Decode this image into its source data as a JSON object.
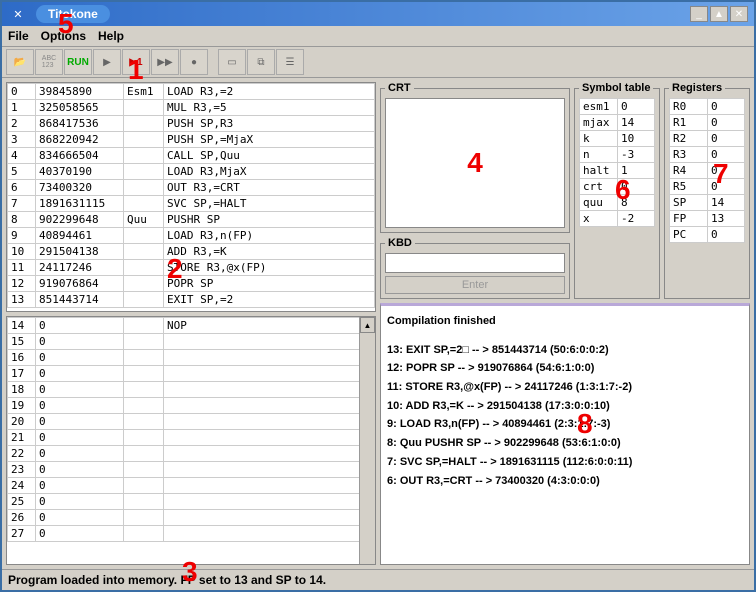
{
  "window": {
    "title": "Titokone"
  },
  "menu": {
    "file": "File",
    "options": "Options",
    "help": "Help"
  },
  "toolbar": {
    "open": "📂",
    "abc": "ABC\n123",
    "run": "RUN",
    "step": "▶",
    "stepn": "▶1",
    "ff": "▶▶",
    "stop": "●"
  },
  "code": [
    {
      "addr": "0",
      "val": "39845890",
      "lbl": "Esm1",
      "inst": "LOAD R3,=2"
    },
    {
      "addr": "1",
      "val": "325058565",
      "lbl": "",
      "inst": "MUL  R3,=5"
    },
    {
      "addr": "2",
      "val": "868417536",
      "lbl": "",
      "inst": "PUSH SP,R3"
    },
    {
      "addr": "3",
      "val": "868220942",
      "lbl": "",
      "inst": "PUSH SP,=MjaX"
    },
    {
      "addr": "4",
      "val": "834666504",
      "lbl": "",
      "inst": "CALL SP,Quu"
    },
    {
      "addr": "5",
      "val": "40370190",
      "lbl": "",
      "inst": "LOAD R3,MjaX"
    },
    {
      "addr": "6",
      "val": "73400320",
      "lbl": "",
      "inst": "OUT  R3,=CRT"
    },
    {
      "addr": "7",
      "val": "1891631115",
      "lbl": "",
      "inst": "SVC  SP,=HALT"
    },
    {
      "addr": "8",
      "val": "902299648",
      "lbl": "Quu",
      "inst": "PUSHR SP"
    },
    {
      "addr": "9",
      "val": "40894461",
      "lbl": "",
      "inst": "LOAD  R3,n(FP)"
    },
    {
      "addr": "10",
      "val": "291504138",
      "lbl": "",
      "inst": "ADD   R3,=K"
    },
    {
      "addr": "11",
      "val": "24117246",
      "lbl": "",
      "inst": "STORE R3,@x(FP)"
    },
    {
      "addr": "12",
      "val": "919076864",
      "lbl": "",
      "inst": "POPR  SP"
    },
    {
      "addr": "13",
      "val": "851443714",
      "lbl": "",
      "inst": "EXIT  SP,=2"
    }
  ],
  "mem": [
    {
      "addr": "14",
      "val": "0",
      "lbl": "",
      "inst": "NOP"
    },
    {
      "addr": "15",
      "val": "0",
      "lbl": "",
      "inst": ""
    },
    {
      "addr": "16",
      "val": "0",
      "lbl": "",
      "inst": ""
    },
    {
      "addr": "17",
      "val": "0",
      "lbl": "",
      "inst": ""
    },
    {
      "addr": "18",
      "val": "0",
      "lbl": "",
      "inst": ""
    },
    {
      "addr": "19",
      "val": "0",
      "lbl": "",
      "inst": ""
    },
    {
      "addr": "20",
      "val": "0",
      "lbl": "",
      "inst": ""
    },
    {
      "addr": "21",
      "val": "0",
      "lbl": "",
      "inst": ""
    },
    {
      "addr": "22",
      "val": "0",
      "lbl": "",
      "inst": ""
    },
    {
      "addr": "23",
      "val": "0",
      "lbl": "",
      "inst": ""
    },
    {
      "addr": "24",
      "val": "0",
      "lbl": "",
      "inst": ""
    },
    {
      "addr": "25",
      "val": "0",
      "lbl": "",
      "inst": ""
    },
    {
      "addr": "26",
      "val": "0",
      "lbl": "",
      "inst": ""
    },
    {
      "addr": "27",
      "val": "0",
      "lbl": "",
      "inst": ""
    }
  ],
  "crt": {
    "legend": "CRT"
  },
  "kbd": {
    "legend": "KBD",
    "enter": "Enter"
  },
  "symtable": {
    "legend": "Symbol table",
    "rows": [
      {
        "k": "esm1",
        "v": "0"
      },
      {
        "k": "mjax",
        "v": "14"
      },
      {
        "k": "k",
        "v": "10"
      },
      {
        "k": "n",
        "v": "-3"
      },
      {
        "k": "halt",
        "v": "1"
      },
      {
        "k": "crt",
        "v": "0"
      },
      {
        "k": "quu",
        "v": "8"
      },
      {
        "k": "x",
        "v": "-2"
      }
    ]
  },
  "registers": {
    "legend": "Registers",
    "rows": [
      {
        "k": "R0",
        "v": "0"
      },
      {
        "k": "R1",
        "v": "0"
      },
      {
        "k": "R2",
        "v": "0"
      },
      {
        "k": "R3",
        "v": "0"
      },
      {
        "k": "R4",
        "v": "0"
      },
      {
        "k": "R5",
        "v": "0"
      },
      {
        "k": "SP",
        "v": "14"
      },
      {
        "k": "FP",
        "v": "13"
      },
      {
        "k": "PC",
        "v": "0"
      }
    ]
  },
  "compile": {
    "title": "Compilation finished",
    "lines": [
      "13:      EXIT  SP,=2□ -- > 851443714 (50:6:0:0:2)",
      "12:      POPR  SP -- > 919076864 (54:6:1:0:0)",
      "11:      STORE R3,@x(FP) -- > 24117246 (1:3:1:7:-2)",
      "10:      ADD   R3,=K -- > 291504138 (17:3:0:0:10)",
      "9:      LOAD  R3,n(FP) -- > 40894461 (2:3:1:7:-3)",
      "8: Quu    PUSHR SP -- > 902299648 (53:6:1:0:0)",
      "7:      SVC   SP,=HALT -- > 1891631115 (112:6:0:0:11)",
      "6:      OUT  R3,=CRT -- > 73400320 (4:3:0:0:0)"
    ]
  },
  "status": "Program loaded into memory. FP set to 13 and SP to 14.",
  "overlays": {
    "n1": "1",
    "n2": "2",
    "n3": "3",
    "n4": "4",
    "n5": "5",
    "n6": "6",
    "n7": "7",
    "n8": "8"
  }
}
